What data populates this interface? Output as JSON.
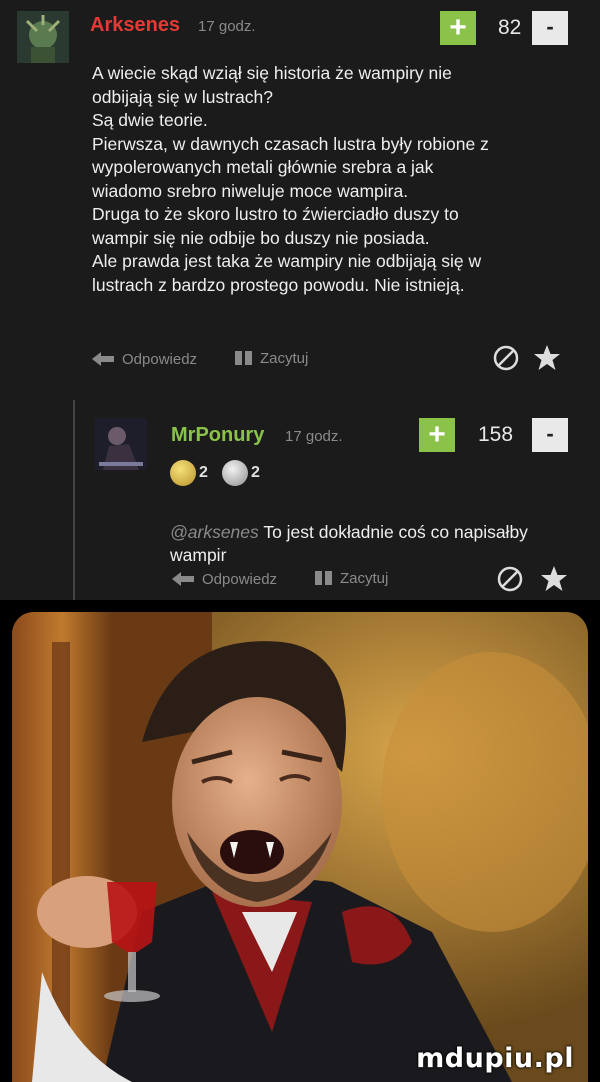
{
  "comments": [
    {
      "username": "Arksenes",
      "username_color": "#e53935",
      "time": "17 godz.",
      "votes": "82",
      "vote_plus": "+",
      "vote_minus": "-",
      "body": "A wiecie skąd wziął się historia że wampiry nie\nodbijają się w lustrach?\nSą dwie teorie.\nPierwsza, w dawnych czasach lustra były robione z\nwypolerowanych metali głównie srebra a jak\nwiadomo srebro niweluje moce wampira.\nDruga to że skoro lustro to źwierciadło duszy to\nwampir się nie odbije bo duszy nie posiada.\nAle prawda jest taka że wampiry nie odbijają się w\nlustrach z bardzo prostego powodu. Nie istnieją.",
      "reply_label": "Odpowiedz",
      "quote_label": "Zacytuj"
    },
    {
      "username": "MrPonury",
      "username_color": "#8bc34a",
      "time": "17 godz.",
      "votes": "158",
      "vote_plus": "+",
      "vote_minus": "-",
      "badge1_count": "2",
      "badge2_count": "2",
      "mention": "@arksenes",
      "body": " To jest dokładnie coś co napisałby\nwampir",
      "reply_label": "Odpowiedz",
      "quote_label": "Zacytuj"
    }
  ],
  "watermark": "mdupiu.pl",
  "icons": [
    "reply-arrow-icon",
    "quote-icon",
    "report-icon",
    "star-icon"
  ]
}
